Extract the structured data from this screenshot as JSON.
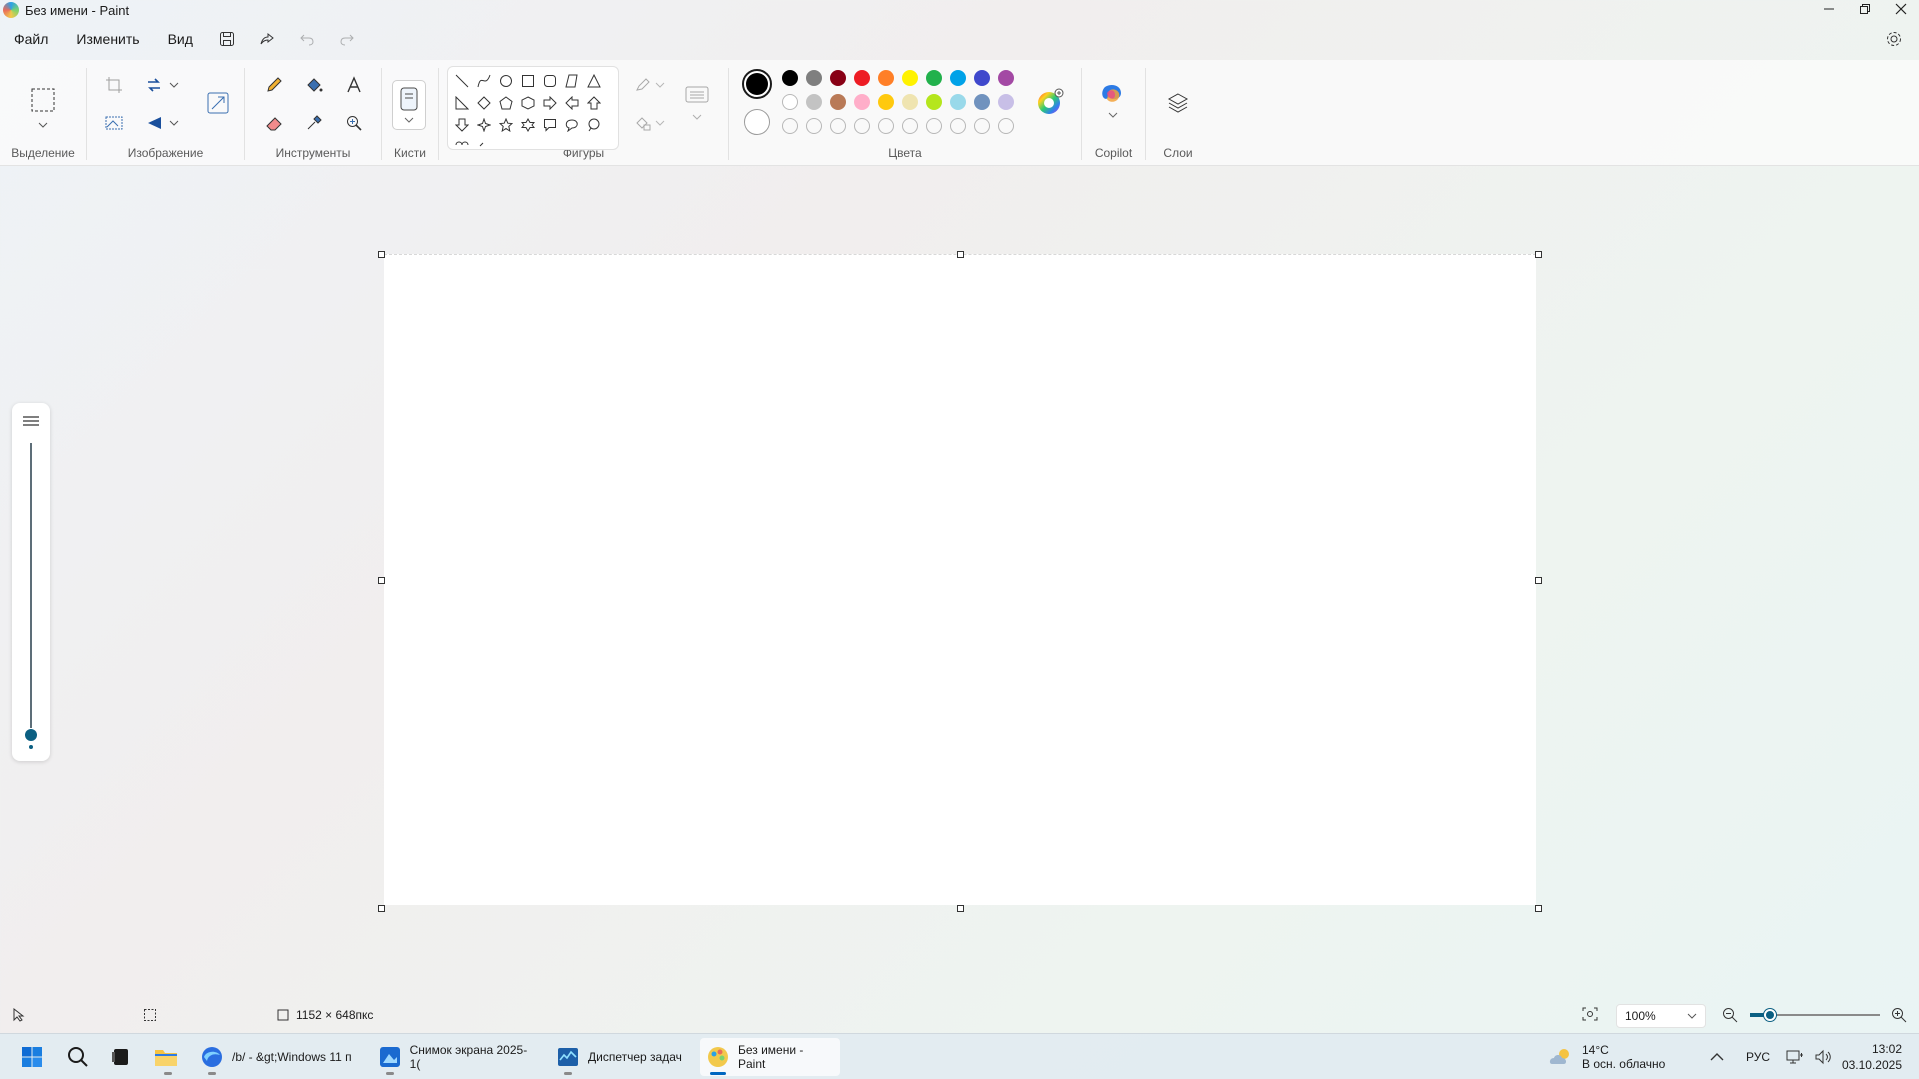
{
  "window": {
    "title": "Без имени - Paint"
  },
  "menu": {
    "file": "Файл",
    "edit": "Изменить",
    "view": "Вид"
  },
  "ribbon": {
    "groups": {
      "selection": "Выделение",
      "image": "Изображение",
      "tools": "Инструменты",
      "brushes": "Кисти",
      "shapes": "Фигуры",
      "colors": "Цвета",
      "copilot": "Copilot",
      "layers": "Слои"
    },
    "palette_row1": [
      "#000000",
      "#7f7f7f",
      "#880015",
      "#ed1c24",
      "#ff7f27",
      "#fff200",
      "#22b14c",
      "#00a2e8",
      "#3f48cc",
      "#a349a4"
    ],
    "palette_row2": [
      "#ffffff",
      "#c3c3c3",
      "#b97a57",
      "#ffaec9",
      "#ffc90e",
      "#efe4b0",
      "#b5e61d",
      "#99d9ea",
      "#7092be",
      "#c8bfe7"
    ],
    "primary_color": "#000000",
    "secondary_color": "#ffffff"
  },
  "status": {
    "canvas_size": "1152 × 648пкс",
    "zoom": "100%"
  },
  "taskbar": {
    "items": [
      {
        "label": "/b/ - &gt;Windows 11 п",
        "icon": "browser-icon"
      },
      {
        "label": "Снимок экрана 2025-1(",
        "icon": "photos-icon"
      },
      {
        "label": "Диспетчер задач",
        "icon": "task-manager-icon"
      },
      {
        "label": "Без имени - Paint",
        "icon": "paint-icon"
      }
    ],
    "weather_temp": "14°C",
    "weather_desc": "В осн. облачно",
    "language": "РУС",
    "time": "13:02",
    "date": "03.10.2025"
  }
}
